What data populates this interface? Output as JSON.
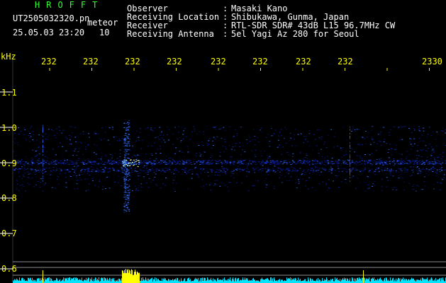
{
  "header": {
    "brand": "HROFFT",
    "filename": "UT2505032320.pn",
    "mode": "meteor",
    "datetime": "25.05.03 23:20",
    "count": "10",
    "fields": [
      {
        "label": "Observer",
        "value": "Masaki Kano"
      },
      {
        "label": "Receiving Location",
        "value": "Shibukawa, Gunma, Japan"
      },
      {
        "label": "Receiver",
        "value": "RTL-SDR SDR# 43dB L15 96.7MHz CW"
      },
      {
        "label": "Receiving Antenna",
        "value": "5el Yagi Az 280 for Seoul"
      }
    ]
  },
  "axes": {
    "y_unit": "kHz",
    "y_ticks": [
      "1.1",
      "1.0",
      "0.9",
      "0.8",
      "0.7",
      "0.6"
    ],
    "time_ticks": [
      "232",
      "232",
      "232",
      "232",
      "232",
      "232",
      "232",
      "232",
      "2330"
    ]
  },
  "colors": {
    "background": "#000000",
    "header_text": "#ffffff",
    "brand": "#33ff33",
    "axis_text": "#ffff00",
    "signal_dim": "#0a1aa0",
    "signal_mid": "#2f6cff",
    "signal_hot": "#ffff66",
    "meter_cyan": "#00e5ff",
    "meter_yellow": "#ffff00"
  }
}
